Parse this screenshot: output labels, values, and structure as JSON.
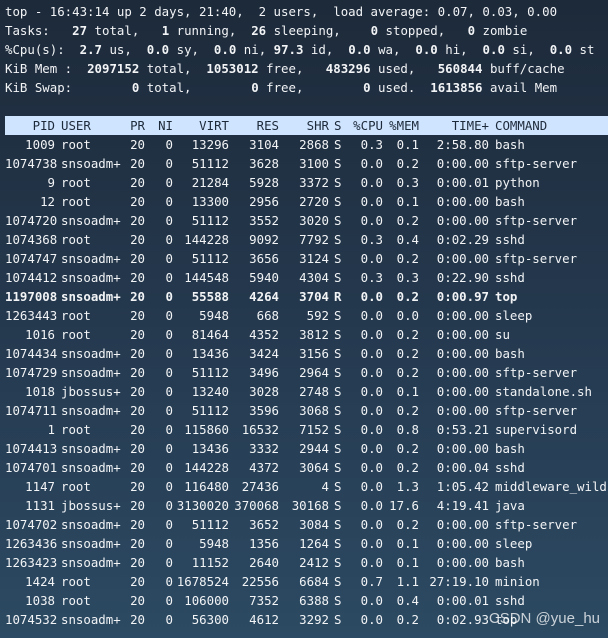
{
  "summary": {
    "line1": "top - 16:43:14 up 2 days, 21:40,  2 users,  load average: 0.07, 0.03, 0.00",
    "tasks_label": "Tasks:",
    "tasks_total": "27",
    "tasks_total_label": " total,",
    "tasks_running": "1",
    "tasks_running_label": " running,",
    "tasks_sleeping": "26",
    "tasks_sleeping_label": " sleeping,",
    "tasks_stopped": "0",
    "tasks_stopped_label": " stopped,",
    "tasks_zombie": "0",
    "tasks_zombie_label": " zombie",
    "cpu_label": "%Cpu(s):",
    "cpu_us": "2.7",
    "cpu_us_label": " us,",
    "cpu_sy": "0.0",
    "cpu_sy_label": " sy,",
    "cpu_ni": "0.0",
    "cpu_ni_label": " ni,",
    "cpu_id": "97.3",
    "cpu_id_label": " id,",
    "cpu_wa": "0.0",
    "cpu_wa_label": " wa,",
    "cpu_hi": "0.0",
    "cpu_hi_label": " hi,",
    "cpu_si": "0.0",
    "cpu_si_label": " si,",
    "cpu_st": "0.0",
    "cpu_st_label": " st",
    "mem_label": "KiB Mem :",
    "mem_total": "2097152",
    "mem_total_label": " total,",
    "mem_free": "1053012",
    "mem_free_label": " free,",
    "mem_used": "483296",
    "mem_used_label": " used,",
    "mem_buff": "560844",
    "mem_buff_label": " buff/cache",
    "swap_label": "KiB Swap:",
    "swap_total": "0",
    "swap_total_label": " total,",
    "swap_free": "0",
    "swap_free_label": " free,",
    "swap_used": "0",
    "swap_used_label": " used.",
    "swap_avail": "1613856",
    "swap_avail_label": " avail Mem"
  },
  "table": {
    "headers": {
      "pid": "PID",
      "user": "USER",
      "pr": "PR",
      "ni": "NI",
      "virt": "VIRT",
      "res": "RES",
      "shr": "SHR",
      "s": "S",
      "cpu": "%CPU",
      "mem": "%MEM",
      "time": "TIME+",
      "command": "COMMAND"
    },
    "rows": [
      {
        "pid": "1009",
        "user": "root",
        "pr": "20",
        "ni": "0",
        "virt": "13296",
        "res": "3104",
        "shr": "2868",
        "s": "S",
        "cpu": "0.3",
        "mem": "0.1",
        "time": "2:58.80",
        "command": "bash"
      },
      {
        "pid": "1074738",
        "user": "snsoadm+",
        "pr": "20",
        "ni": "0",
        "virt": "51112",
        "res": "3628",
        "shr": "3100",
        "s": "S",
        "cpu": "0.0",
        "mem": "0.2",
        "time": "0:00.00",
        "command": "sftp-server"
      },
      {
        "pid": "9",
        "user": "root",
        "pr": "20",
        "ni": "0",
        "virt": "21284",
        "res": "5928",
        "shr": "3372",
        "s": "S",
        "cpu": "0.0",
        "mem": "0.3",
        "time": "0:00.01",
        "command": "python"
      },
      {
        "pid": "12",
        "user": "root",
        "pr": "20",
        "ni": "0",
        "virt": "13300",
        "res": "2956",
        "shr": "2720",
        "s": "S",
        "cpu": "0.0",
        "mem": "0.1",
        "time": "0:00.00",
        "command": "bash"
      },
      {
        "pid": "1074720",
        "user": "snsoadm+",
        "pr": "20",
        "ni": "0",
        "virt": "51112",
        "res": "3552",
        "shr": "3020",
        "s": "S",
        "cpu": "0.0",
        "mem": "0.2",
        "time": "0:00.00",
        "command": "sftp-server"
      },
      {
        "pid": "1074368",
        "user": "root",
        "pr": "20",
        "ni": "0",
        "virt": "144228",
        "res": "9092",
        "shr": "7792",
        "s": "S",
        "cpu": "0.3",
        "mem": "0.4",
        "time": "0:02.29",
        "command": "sshd"
      },
      {
        "pid": "1074747",
        "user": "snsoadm+",
        "pr": "20",
        "ni": "0",
        "virt": "51112",
        "res": "3656",
        "shr": "3124",
        "s": "S",
        "cpu": "0.0",
        "mem": "0.2",
        "time": "0:00.00",
        "command": "sftp-server"
      },
      {
        "pid": "1074412",
        "user": "snsoadm+",
        "pr": "20",
        "ni": "0",
        "virt": "144548",
        "res": "5940",
        "shr": "4304",
        "s": "S",
        "cpu": "0.3",
        "mem": "0.3",
        "time": "0:22.90",
        "command": "sshd"
      },
      {
        "pid": "1197008",
        "user": "snsoadm+",
        "pr": "20",
        "ni": "0",
        "virt": "55588",
        "res": "4264",
        "shr": "3704",
        "s": "R",
        "cpu": "0.0",
        "mem": "0.2",
        "time": "0:00.97",
        "command": "top",
        "highlight": true
      },
      {
        "pid": "1263443",
        "user": "root",
        "pr": "20",
        "ni": "0",
        "virt": "5948",
        "res": "668",
        "shr": "592",
        "s": "S",
        "cpu": "0.0",
        "mem": "0.0",
        "time": "0:00.00",
        "command": "sleep"
      },
      {
        "pid": "1016",
        "user": "root",
        "pr": "20",
        "ni": "0",
        "virt": "81464",
        "res": "4352",
        "shr": "3812",
        "s": "S",
        "cpu": "0.0",
        "mem": "0.2",
        "time": "0:00.00",
        "command": "su"
      },
      {
        "pid": "1074434",
        "user": "snsoadm+",
        "pr": "20",
        "ni": "0",
        "virt": "13436",
        "res": "3424",
        "shr": "3156",
        "s": "S",
        "cpu": "0.0",
        "mem": "0.2",
        "time": "0:00.00",
        "command": "bash"
      },
      {
        "pid": "1074729",
        "user": "snsoadm+",
        "pr": "20",
        "ni": "0",
        "virt": "51112",
        "res": "3496",
        "shr": "2964",
        "s": "S",
        "cpu": "0.0",
        "mem": "0.2",
        "time": "0:00.00",
        "command": "sftp-server"
      },
      {
        "pid": "1018",
        "user": "jbossus+",
        "pr": "20",
        "ni": "0",
        "virt": "13240",
        "res": "3028",
        "shr": "2748",
        "s": "S",
        "cpu": "0.0",
        "mem": "0.1",
        "time": "0:00.00",
        "command": "standalone.sh"
      },
      {
        "pid": "1074711",
        "user": "snsoadm+",
        "pr": "20",
        "ni": "0",
        "virt": "51112",
        "res": "3596",
        "shr": "3068",
        "s": "S",
        "cpu": "0.0",
        "mem": "0.2",
        "time": "0:00.00",
        "command": "sftp-server"
      },
      {
        "pid": "1",
        "user": "root",
        "pr": "20",
        "ni": "0",
        "virt": "115860",
        "res": "16532",
        "shr": "7152",
        "s": "S",
        "cpu": "0.0",
        "mem": "0.8",
        "time": "0:53.21",
        "command": "supervisord"
      },
      {
        "pid": "1074413",
        "user": "snsoadm+",
        "pr": "20",
        "ni": "0",
        "virt": "13436",
        "res": "3332",
        "shr": "2944",
        "s": "S",
        "cpu": "0.0",
        "mem": "0.2",
        "time": "0:00.00",
        "command": "bash"
      },
      {
        "pid": "1074701",
        "user": "snsoadm+",
        "pr": "20",
        "ni": "0",
        "virt": "144228",
        "res": "4372",
        "shr": "3064",
        "s": "S",
        "cpu": "0.0",
        "mem": "0.2",
        "time": "0:00.04",
        "command": "sshd"
      },
      {
        "pid": "1147",
        "user": "root",
        "pr": "20",
        "ni": "0",
        "virt": "116480",
        "res": "27436",
        "shr": "4",
        "s": "S",
        "cpu": "0.0",
        "mem": "1.3",
        "time": "1:05.42",
        "command": "middleware_wild"
      },
      {
        "pid": "1131",
        "user": "jbossus+",
        "pr": "20",
        "ni": "0",
        "virt": "3130020",
        "res": "370068",
        "shr": "30168",
        "s": "S",
        "cpu": "0.0",
        "mem": "17.6",
        "time": "4:19.41",
        "command": "java"
      },
      {
        "pid": "1074702",
        "user": "snsoadm+",
        "pr": "20",
        "ni": "0",
        "virt": "51112",
        "res": "3652",
        "shr": "3084",
        "s": "S",
        "cpu": "0.0",
        "mem": "0.2",
        "time": "0:00.00",
        "command": "sftp-server"
      },
      {
        "pid": "1263436",
        "user": "snsoadm+",
        "pr": "20",
        "ni": "0",
        "virt": "5948",
        "res": "1356",
        "shr": "1264",
        "s": "S",
        "cpu": "0.0",
        "mem": "0.1",
        "time": "0:00.00",
        "command": "sleep"
      },
      {
        "pid": "1263423",
        "user": "snsoadm+",
        "pr": "20",
        "ni": "0",
        "virt": "11152",
        "res": "2640",
        "shr": "2412",
        "s": "S",
        "cpu": "0.0",
        "mem": "0.1",
        "time": "0:00.00",
        "command": "bash"
      },
      {
        "pid": "1424",
        "user": "root",
        "pr": "20",
        "ni": "0",
        "virt": "1678524",
        "res": "22556",
        "shr": "6684",
        "s": "S",
        "cpu": "0.7",
        "mem": "1.1",
        "time": "27:19.10",
        "command": "minion"
      },
      {
        "pid": "1038",
        "user": "root",
        "pr": "20",
        "ni": "0",
        "virt": "106000",
        "res": "7352",
        "shr": "6388",
        "s": "S",
        "cpu": "0.0",
        "mem": "0.4",
        "time": "0:00.01",
        "command": "sshd"
      },
      {
        "pid": "1074532",
        "user": "snsoadm+",
        "pr": "20",
        "ni": "0",
        "virt": "56300",
        "res": "4612",
        "shr": "3292",
        "s": "S",
        "cpu": "0.0",
        "mem": "0.2",
        "time": "0:02.93",
        "command": "top"
      }
    ]
  },
  "watermark": "CSDN @yue_hu"
}
